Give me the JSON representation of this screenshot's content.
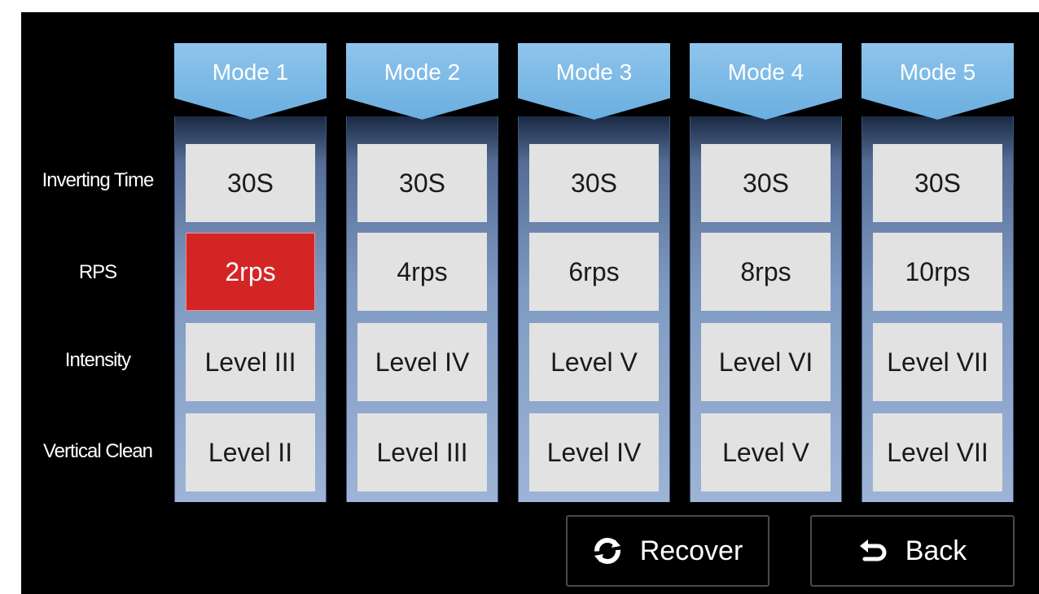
{
  "row_labels": [
    "Inverting Time",
    "RPS",
    "Intensity",
    "Vertical Clean"
  ],
  "modes": [
    {
      "label": "Mode 1",
      "inverting_time": "30S",
      "rps": "2rps",
      "intensity": "Level  III",
      "vertical_clean": "Level  II"
    },
    {
      "label": "Mode 2",
      "inverting_time": "30S",
      "rps": "4rps",
      "intensity": "Level  IV",
      "vertical_clean": "Level  III"
    },
    {
      "label": "Mode 3",
      "inverting_time": "30S",
      "rps": "6rps",
      "intensity": "Level  V",
      "vertical_clean": "Level  IV"
    },
    {
      "label": "Mode 4",
      "inverting_time": "30S",
      "rps": "8rps",
      "intensity": "Level  VI",
      "vertical_clean": "Level  V"
    },
    {
      "label": "Mode 5",
      "inverting_time": "30S",
      "rps": "10rps",
      "intensity": "Level  VII",
      "vertical_clean": "Level  VII"
    }
  ],
  "selected_cell": {
    "mode": 1,
    "field": "rps"
  },
  "buttons": {
    "recover": {
      "label": "Recover",
      "icon": "refresh-icon"
    },
    "back": {
      "label": "Back",
      "icon": "return-arrow-icon"
    }
  },
  "colors": {
    "header": "#79b8e6",
    "selected": "#d42525",
    "cell": "#e2e2e2",
    "background": "#000000"
  }
}
